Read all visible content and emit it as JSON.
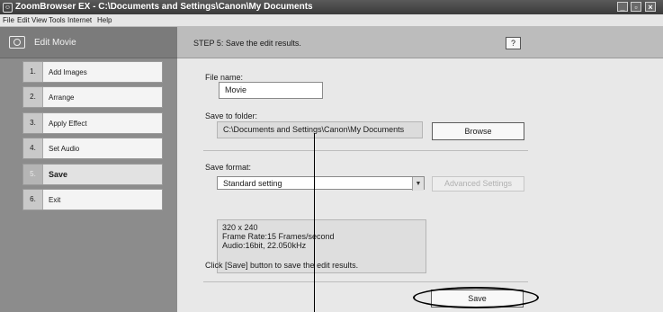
{
  "window": {
    "title": "ZoomBrowser EX  -  C:\\Documents and Settings\\Canon\\My Documents",
    "controls": {
      "minimize": "_",
      "maximize": "▫",
      "close": "×"
    }
  },
  "menu": [
    "File",
    "Edit",
    "View",
    "Tools",
    "Internet",
    "Help"
  ],
  "left_panel": {
    "mode_label": "Edit Movie",
    "steps": [
      {
        "num": "1.",
        "label": "Add Images"
      },
      {
        "num": "2.",
        "label": "Arrange"
      },
      {
        "num": "3.",
        "label": "Apply Effect"
      },
      {
        "num": "4.",
        "label": "Set Audio"
      },
      {
        "num": "5.",
        "label": "Save",
        "active": true
      },
      {
        "num": "6.",
        "label": "Exit"
      }
    ]
  },
  "main": {
    "step_title": "STEP 5: Save the edit results.",
    "help_label": "?",
    "file_name_label": "File name:",
    "file_name_value": "Movie",
    "save_folder_label": "Save to folder:",
    "save_folder_value": "C:\\Documents and Settings\\Canon\\My Documents",
    "browse_label": "Browse",
    "save_format_label": "Save format:",
    "save_format_value": "Standard setting",
    "advanced_label": "Advanced Settings",
    "details": [
      "320 x 240",
      "Frame Rate:15 Frames/second",
      "Audio:16bit, 22.050kHz"
    ],
    "instruction": "Click [Save] button to save the edit results.",
    "save_label": "Save"
  }
}
